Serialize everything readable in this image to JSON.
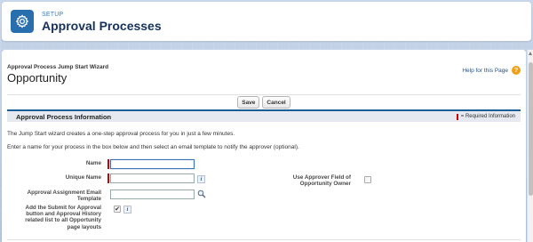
{
  "header": {
    "eyebrow": "SETUP",
    "title": "Approval Processes",
    "icon": "gear-icon"
  },
  "wizard": {
    "subtitle": "Approval Process Jump Start Wizard",
    "title": "Opportunity",
    "help_label": "Help for this Page",
    "help_icon": "help-icon"
  },
  "toolbar": {
    "save_label": "Save",
    "cancel_label": "Cancel"
  },
  "section": {
    "title": "Approval Process Information",
    "required_label": "= Required Information"
  },
  "intro": {
    "line1": "The Jump Start wizard creates a one-step approval process for you in just a few minutes.",
    "line2": "Enter a name for your process in the box below and then select an email template to notify the approver (optional)."
  },
  "form": {
    "name_label": "Name",
    "name_value": "",
    "unique_name_label": "Unique Name",
    "unique_name_value": "",
    "email_template_label_1": "Approval Assignment Email",
    "email_template_label_2": "Template",
    "email_template_value": "",
    "add_submit_label_1": "Add the Submit for Approval",
    "add_submit_label_2": "button and Approval History",
    "add_submit_label_3": "related list to all Opportunity",
    "add_submit_label_4": "page layouts",
    "add_submit_checked": true,
    "use_field_label_1": "Use Approver Field of",
    "use_field_label_2": "Opportunity Owner",
    "use_field_checked": false
  },
  "colors": {
    "brand_blue": "#1a5f94",
    "required_red": "#cc0000",
    "help_orange": "#f0a014"
  }
}
